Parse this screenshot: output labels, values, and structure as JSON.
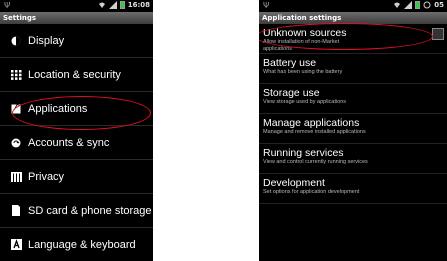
{
  "left_screen": {
    "status_time": "16:08",
    "title": "Settings",
    "items": [
      {
        "label": "Display",
        "icon": "display-icon"
      },
      {
        "label": "Location & security",
        "icon": "location-icon"
      },
      {
        "label": "Applications",
        "icon": "applications-icon"
      },
      {
        "label": "Accounts & sync",
        "icon": "sync-icon"
      },
      {
        "label": "Privacy",
        "icon": "privacy-icon"
      },
      {
        "label": "SD card & phone storage",
        "icon": "sd-card-icon"
      },
      {
        "label": "Language & keyboard",
        "icon": "keyboard-icon"
      }
    ]
  },
  "right_screen": {
    "status_time": "05",
    "title": "Application settings",
    "items": [
      {
        "title": "Unknown sources",
        "summary": "Allow installation of non-Market applications"
      },
      {
        "title": "Battery use",
        "summary": "What has been using the battery"
      },
      {
        "title": "Storage use",
        "summary": "View storage used by applications"
      },
      {
        "title": "Manage applications",
        "summary": "Manage and remove installed applications"
      },
      {
        "title": "Running services",
        "summary": "View and control currently running services"
      },
      {
        "title": "Development",
        "summary": "Set options for application development"
      }
    ]
  },
  "colors": {
    "highlight": "#e01020",
    "battery": "#2ecc40"
  }
}
